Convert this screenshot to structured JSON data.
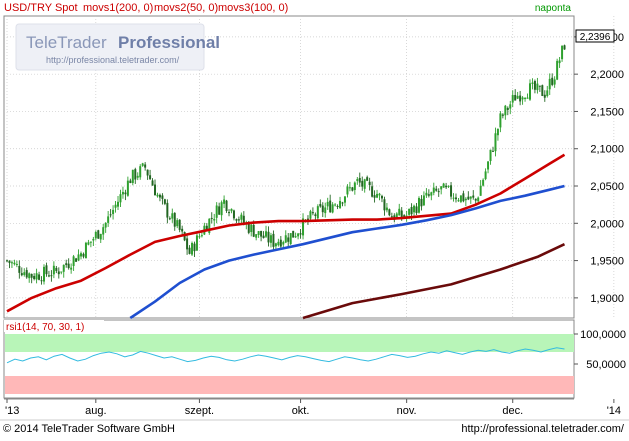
{
  "header": {
    "instrument": "USD/TRY Spot",
    "indicators": [
      {
        "label": "movs1(200, 0)",
        "color": "#c00000"
      },
      {
        "label": "movs2(50, 0)",
        "color": "#c00000"
      },
      {
        "label": "movs3(100, 0)",
        "color": "#c00000"
      }
    ],
    "period_label": "naponta"
  },
  "watermark": {
    "brand_light": "TeleTrader",
    "brand_bold": "Professional",
    "url": "http://professional.teletrader.com/"
  },
  "last_price_badge": "2,2396",
  "rsi_label": "rsi1(14, 70, 30, 1)",
  "footer": {
    "copyright": "© 2014  TeleTrader Software GmbH",
    "url": "http://professional.teletrader.com/"
  },
  "colors": {
    "up_candle": "#2ea02e",
    "down_candle": "#226622",
    "ma_short": "#cc0000",
    "ma_mid": "#1f4fd0",
    "ma_long": "#6a0a0a",
    "rsi_line": "#33bbe0",
    "rsi_overbought_band": "#b8f5b8",
    "rsi_oversold_band": "#ffb8b8",
    "header_green": "#009900",
    "header_red": "#cc0000"
  },
  "chart_data": [
    {
      "type": "candlestick",
      "title": "USD/TRY Spot",
      "x_tick_labels": [
        "'13",
        "aug.",
        "szept.",
        "okt.",
        "nov.",
        "dec.",
        "'14"
      ],
      "y_tick_labels": [
        "1,9000",
        "1,9500",
        "2,0000",
        "2,0500",
        "2,1000",
        "2,1500",
        "2,2000",
        "2,2500"
      ],
      "ylim": [
        1.873,
        2.278
      ],
      "grid": true,
      "last_value": 2.2396,
      "close_path": [
        [
          0,
          1.95
        ],
        [
          10,
          1.93
        ],
        [
          20,
          1.935
        ],
        [
          30,
          1.96
        ],
        [
          40,
          2.0
        ],
        [
          50,
          2.06
        ],
        [
          56,
          2.075
        ],
        [
          62,
          2.03
        ],
        [
          70,
          1.99
        ],
        [
          74,
          1.96
        ],
        [
          80,
          1.995
        ],
        [
          88,
          2.03
        ],
        [
          96,
          2.0
        ],
        [
          102,
          1.985
        ],
        [
          108,
          1.975
        ],
        [
          116,
          1.985
        ],
        [
          124,
          2.01
        ],
        [
          134,
          2.03
        ],
        [
          142,
          2.055
        ],
        [
          150,
          2.04
        ],
        [
          156,
          2.01
        ],
        [
          162,
          2.01
        ],
        [
          168,
          2.03
        ],
        [
          176,
          2.045
        ],
        [
          184,
          2.035
        ],
        [
          190,
          2.03
        ],
        [
          195,
          2.08
        ],
        [
          200,
          2.14
        ],
        [
          206,
          2.17
        ],
        [
          212,
          2.18
        ],
        [
          218,
          2.175
        ],
        [
          222,
          2.2
        ],
        [
          226,
          2.24
        ]
      ],
      "series": [
        {
          "name": "movs1(200, 0)",
          "color": "#cc0000",
          "points": [
            [
              0,
              1.882
            ],
            [
              10,
              1.9
            ],
            [
              20,
              1.913
            ],
            [
              30,
              1.923
            ],
            [
              40,
              1.94
            ],
            [
              50,
              1.958
            ],
            [
              60,
              1.975
            ],
            [
              70,
              1.983
            ],
            [
              80,
              1.99
            ],
            [
              90,
              1.997
            ],
            [
              100,
              2.001
            ],
            [
              110,
              2.003
            ],
            [
              120,
              2.003
            ],
            [
              130,
              2.004
            ],
            [
              140,
              2.005
            ],
            [
              150,
              2.005
            ],
            [
              160,
              2.007
            ],
            [
              170,
              2.01
            ],
            [
              180,
              2.013
            ],
            [
              190,
              2.025
            ],
            [
              200,
              2.04
            ],
            [
              210,
              2.06
            ],
            [
              220,
              2.08
            ],
            [
              226,
              2.092
            ]
          ]
        },
        {
          "name": "movs2(50, 0)",
          "color": "#1f4fd0",
          "points": [
            [
              50,
              1.873
            ],
            [
              60,
              1.895
            ],
            [
              70,
              1.92
            ],
            [
              80,
              1.938
            ],
            [
              90,
              1.95
            ],
            [
              100,
              1.958
            ],
            [
              110,
              1.965
            ],
            [
              120,
              1.972
            ],
            [
              130,
              1.98
            ],
            [
              140,
              1.988
            ],
            [
              150,
              1.993
            ],
            [
              160,
              1.998
            ],
            [
              170,
              2.004
            ],
            [
              180,
              2.011
            ],
            [
              190,
              2.02
            ],
            [
              200,
              2.03
            ],
            [
              210,
              2.037
            ],
            [
              220,
              2.045
            ],
            [
              226,
              2.05
            ]
          ]
        },
        {
          "name": "movs3(100, 0)",
          "color": "#6a0a0a",
          "points": [
            [
              120,
              1.873
            ],
            [
              140,
              1.893
            ],
            [
              160,
              1.905
            ],
            [
              180,
              1.918
            ],
            [
              200,
              1.938
            ],
            [
              215,
              1.955
            ],
            [
              226,
              1.972
            ]
          ]
        }
      ]
    },
    {
      "type": "line",
      "title": "rsi1(14, 70, 30, 1)",
      "y_tick_labels": [
        "50,0000",
        "100,0000"
      ],
      "ylim": [
        0,
        100
      ],
      "bands": [
        {
          "from": 70,
          "to": 100
        },
        {
          "from": 0,
          "to": 30
        }
      ],
      "series": [
        {
          "name": "rsi1(14, 70, 30, 1)",
          "color": "#33bbe0",
          "values": [
            52,
            58,
            55,
            60,
            62,
            57,
            63,
            66,
            60,
            55,
            58,
            64,
            68,
            70,
            67,
            62,
            65,
            71,
            68,
            64,
            60,
            62,
            58,
            54,
            56,
            60,
            63,
            61,
            57,
            55,
            58,
            62,
            65,
            63,
            60,
            57,
            61,
            64,
            62,
            59,
            56,
            54,
            58,
            62,
            60,
            57,
            55,
            58,
            62,
            66,
            64,
            61,
            63,
            67,
            70,
            68,
            72,
            69,
            66,
            70,
            73,
            71,
            74,
            70,
            68,
            72,
            75,
            73,
            70,
            74,
            77,
            75
          ]
        }
      ]
    }
  ]
}
